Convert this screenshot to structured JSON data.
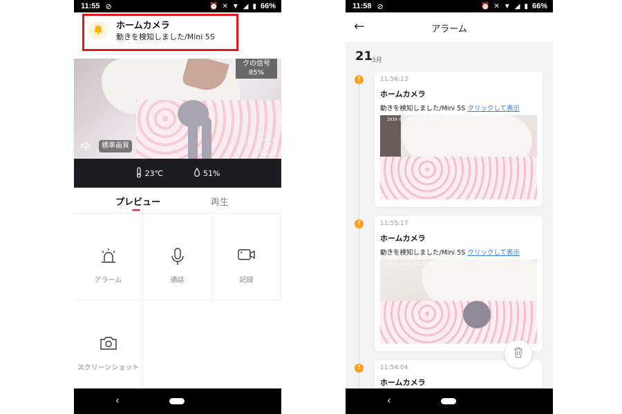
{
  "left_screen": {
    "status_bar": {
      "time": "11:55",
      "battery": "66%"
    },
    "notification": {
      "title": "ホームカメラ",
      "body": "動きを検知しました/Mini 5S"
    },
    "camera": {
      "signal_label": "クの信号",
      "signal_value": "85%",
      "quality_label": "標準画質",
      "temperature": "23℃",
      "humidity": "51%"
    },
    "tabs": [
      {
        "label": "プレビュー",
        "active": true
      },
      {
        "label": "再生",
        "active": false
      }
    ],
    "actions": [
      {
        "label": "アラーム",
        "icon": "siren-icon"
      },
      {
        "label": "通話",
        "icon": "microphone-icon"
      },
      {
        "label": "記録",
        "icon": "video-camera-icon"
      },
      {
        "label": "スクリーンショット",
        "icon": "camera-icon"
      }
    ]
  },
  "right_screen": {
    "status_bar": {
      "time": "11:58",
      "battery": "66%"
    },
    "title": "アラーム",
    "date": {
      "day": "21",
      "month": "3月"
    },
    "entries": [
      {
        "time": "11:56:13",
        "title": "ホームカメラ",
        "body": "動きを検知しました/Mini 5S ",
        "link": "クリックして表示",
        "stamp": "2019-03-21 11:56:08"
      },
      {
        "time": "11:55:17",
        "title": "ホームカメラ",
        "body": "動きを検知しました/Mini 5S ",
        "link": "クリックして表示",
        "stamp": "2019-03-21 11:55:12"
      },
      {
        "time": "11:54:04",
        "title": "ホームカメラ"
      }
    ]
  },
  "colors": {
    "accent_pink": "#ff3d6e",
    "alert_orange": "#ff9f1a",
    "link_blue": "#2f7de1",
    "highlight_red": "#e5131b"
  }
}
